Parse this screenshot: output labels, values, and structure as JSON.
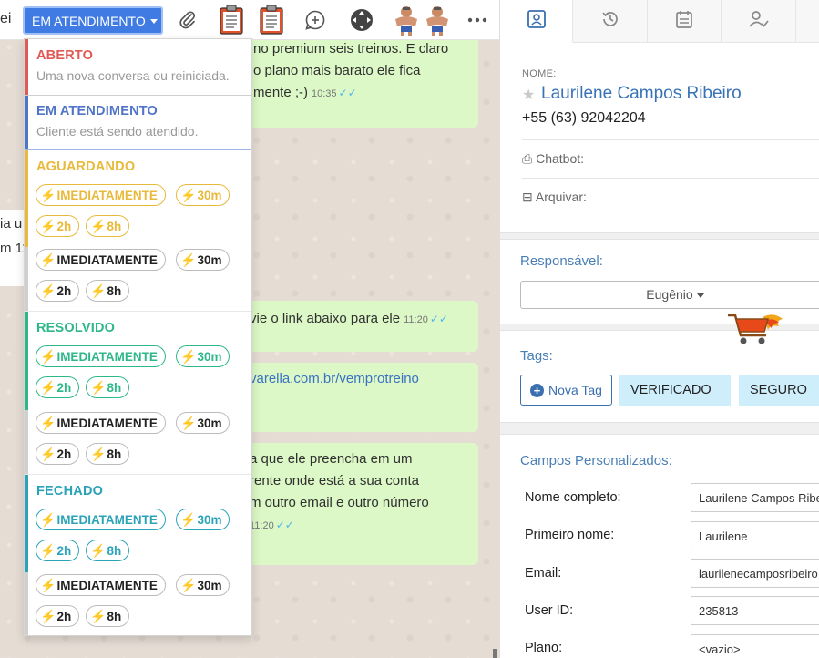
{
  "chat": {
    "contact_name_cut": "ei",
    "status_button": "EM ATENDIMENTO",
    "left_cut_lines": [
      "ia u",
      "m 11"
    ],
    "messages": [
      {
        "lines": [
          "no premium seis treinos. E claro",
          "o plano mais barato ele fica",
          "mente ;-)"
        ],
        "time": "10:35"
      },
      {
        "lines": [
          "vie o link abaixo para ele"
        ],
        "time": "11:20"
      },
      {
        "lines": [
          "varella.com.br/vemprotreino"
        ],
        "time": ""
      },
      {
        "lines": [
          "a que ele preencha em um",
          "rente onde está a sua conta",
          "m outro email e outro número"
        ],
        "time": "11:20"
      }
    ]
  },
  "dropdown": {
    "aberto": {
      "title": "ABERTO",
      "desc": "Uma nova conversa ou reiniciada.",
      "color": "#e05a55"
    },
    "em_atendimento": {
      "title": "EM ATENDIMENTO",
      "desc": "Cliente está sendo atendido.",
      "color": "#4f74c8"
    },
    "aguardando": {
      "title": "AGUARDANDO",
      "color": "#e8b93a"
    },
    "resolvido": {
      "title": "RESOLVIDO",
      "color": "#2eb88a"
    },
    "fechado": {
      "title": "FECHADO",
      "color": "#2aa3b8"
    },
    "pills": {
      "immediately": "IMEDIATAMENTE",
      "m30": "30m",
      "h2": "2h",
      "h8": "8h"
    }
  },
  "contact": {
    "name_label": "NOME:",
    "name": "Laurilene Campos Ribeiro",
    "phone": "+55 (63) 92042204",
    "chatbot_label": "Chatbot:",
    "archive_label": "Arquivar:",
    "responsavel_label": "Responsável:",
    "responsavel_value": "Eugênio",
    "tags_label": "Tags:",
    "new_tag_label": "Nova Tag",
    "tags": [
      "VERIFICADO",
      "SEGURO"
    ],
    "custom_fields_label": "Campos Personalizados:",
    "fields": [
      {
        "label": "Nome completo:",
        "value": "Laurilene Campos Ribeiro"
      },
      {
        "label": "Primeiro nome:",
        "value": "Laurilene"
      },
      {
        "label": "Email:",
        "value": "laurilenecamposribeiro"
      },
      {
        "label": "User ID:",
        "value": "235813"
      },
      {
        "label": "Plano:",
        "value": "<vazio>"
      }
    ]
  },
  "colors": {
    "accent": "#3f7be3",
    "bubble": "#dcf8c6",
    "link": "#3873b8",
    "tag_bg": "#cfeefc"
  },
  "icons": [
    "paperclip-icon",
    "clipboard-icon",
    "clipboard-icon",
    "chat-plus-icon",
    "move-icon",
    "avatar-icon",
    "more-icon",
    "contact-card-icon",
    "history-icon",
    "calendar-icon",
    "user-check-icon",
    "shopping-cart-icon",
    "star-icon"
  ]
}
